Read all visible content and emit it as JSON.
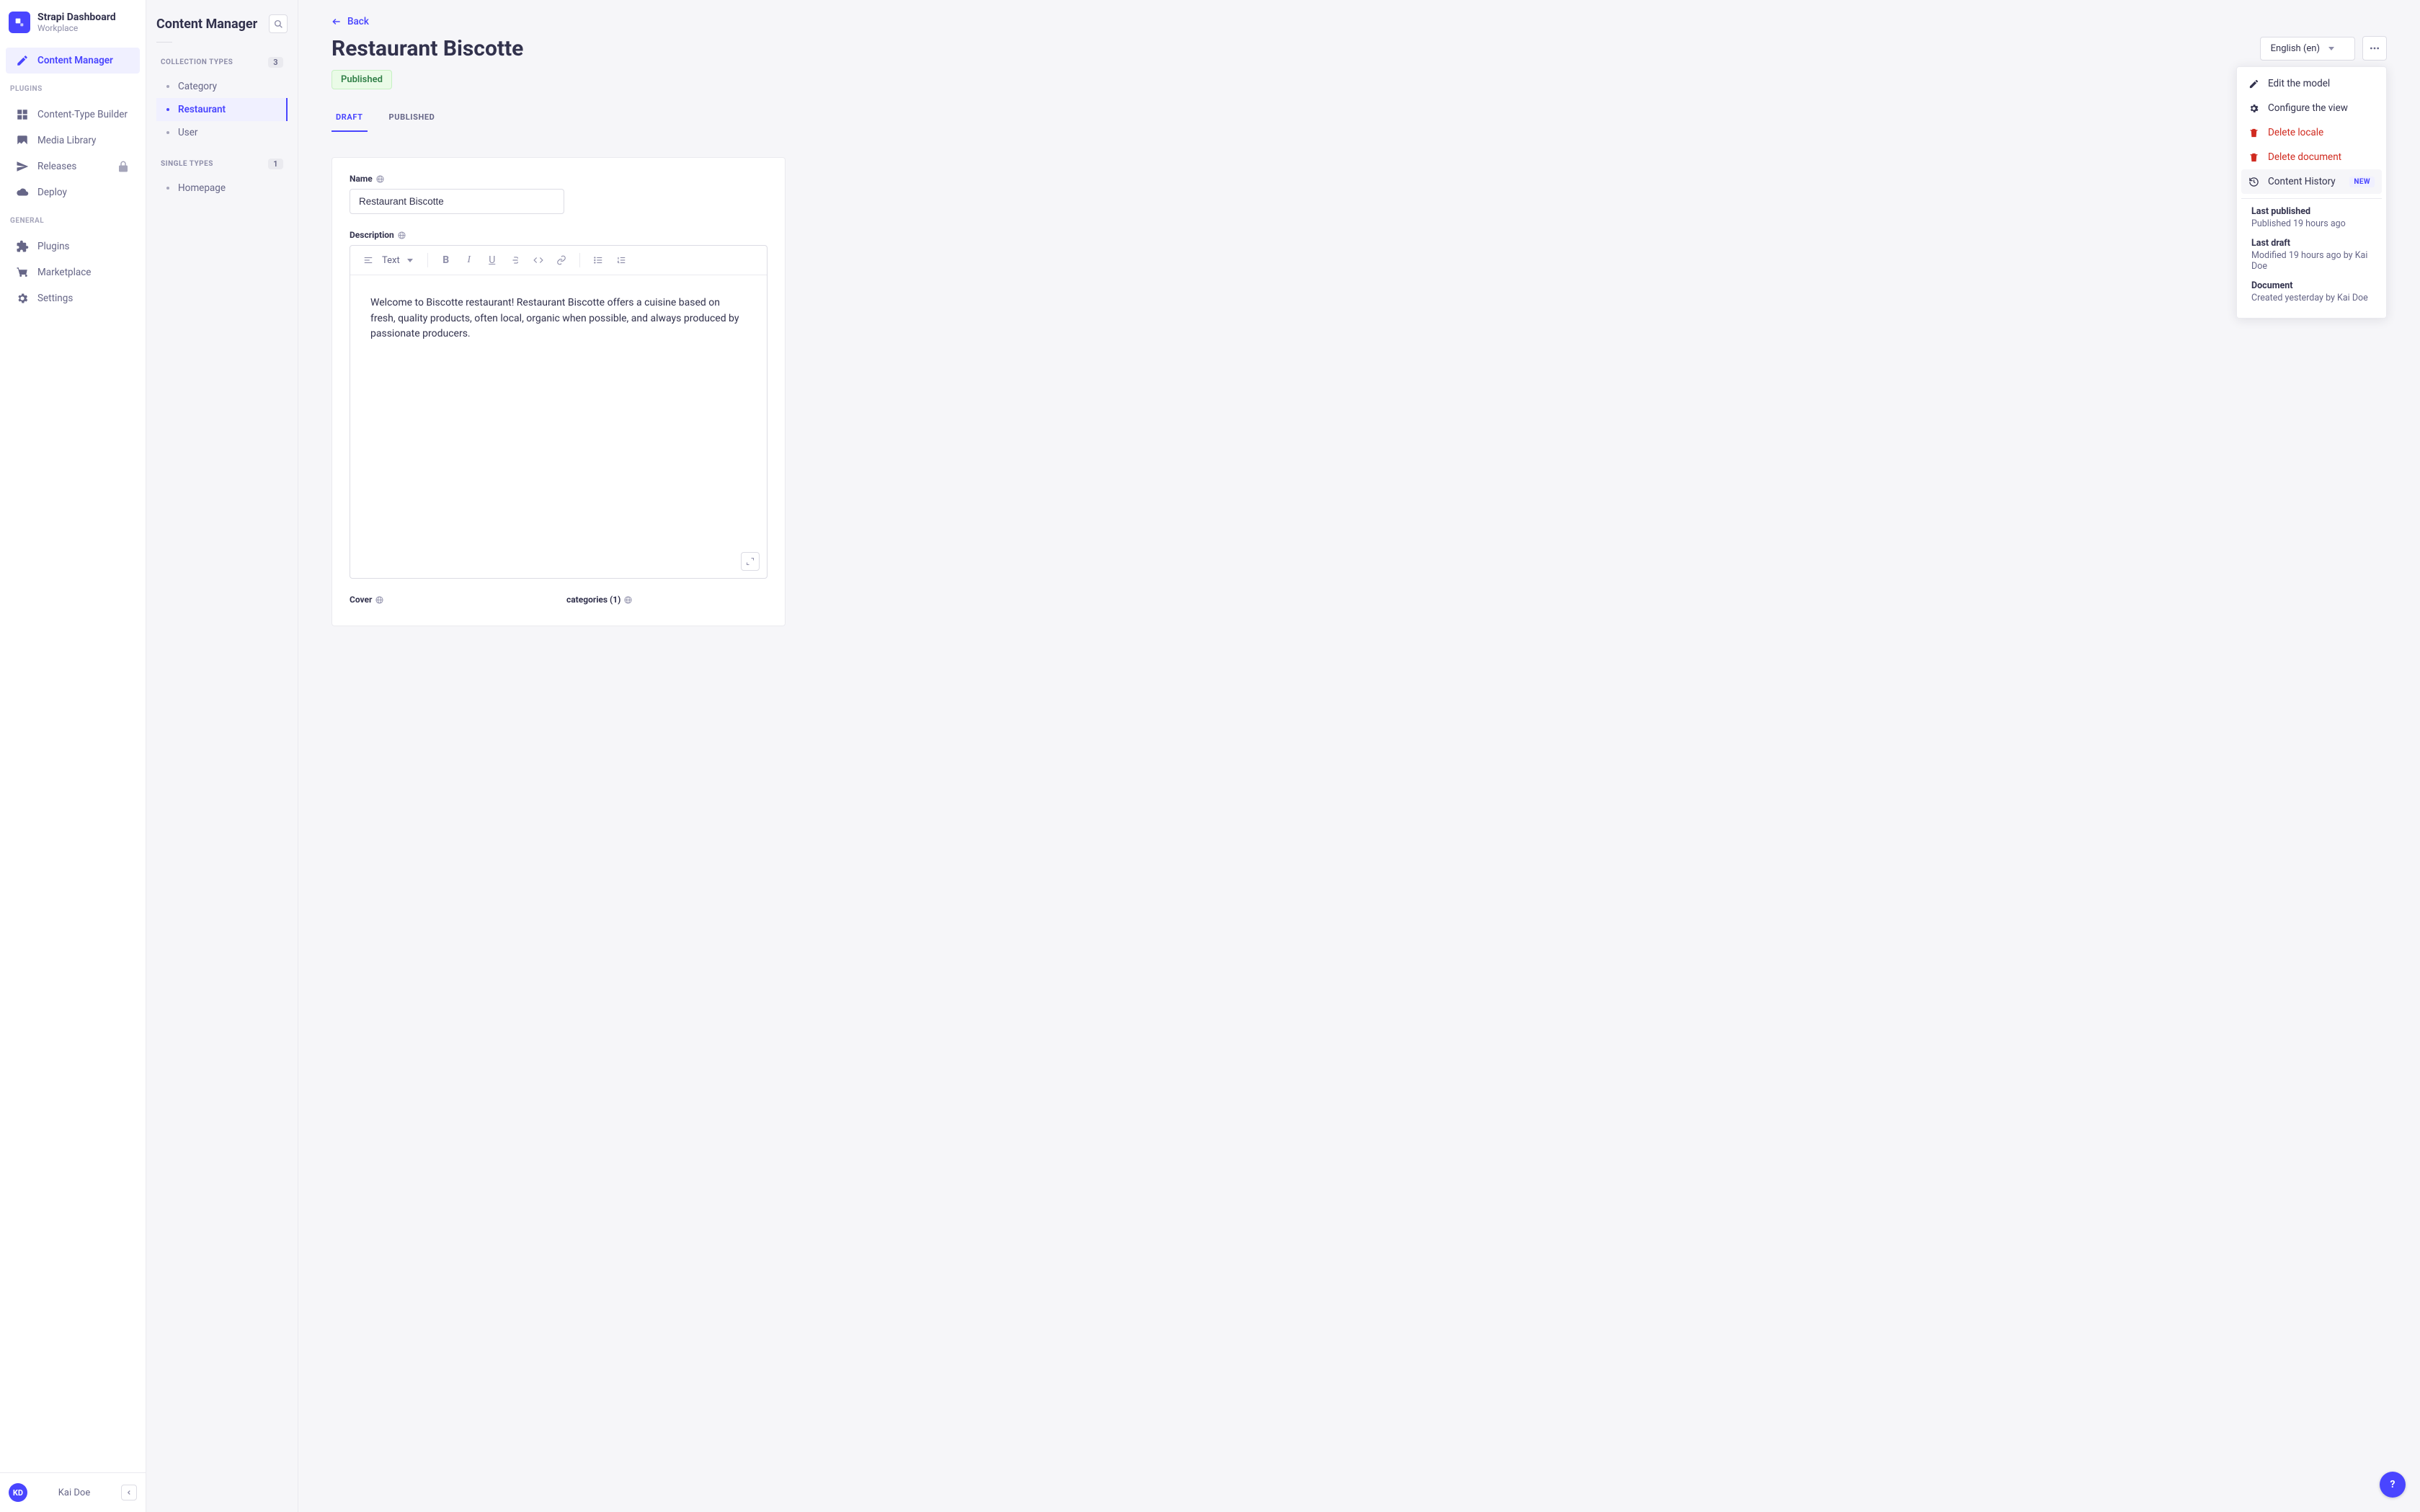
{
  "brand": {
    "title": "Strapi Dashboard",
    "subtitle": "Workplace"
  },
  "nav": {
    "main": {
      "content_manager": "Content Manager"
    },
    "plugins_heading": "PLUGINS",
    "plugins": {
      "content_type_builder": "Content-Type Builder",
      "media_library": "Media Library",
      "releases": "Releases",
      "deploy": "Deploy"
    },
    "general_heading": "GENERAL",
    "general": {
      "plugins": "Plugins",
      "marketplace": "Marketplace",
      "settings": "Settings"
    }
  },
  "user": {
    "initials": "KD",
    "name": "Kai Doe"
  },
  "second": {
    "title": "Content Manager",
    "collection_heading": "COLLECTION TYPES",
    "collection_count": "3",
    "collection_items": {
      "category": "Category",
      "restaurant": "Restaurant",
      "user": "User"
    },
    "single_heading": "SINGLE TYPES",
    "single_count": "1",
    "single_items": {
      "homepage": "Homepage"
    }
  },
  "page": {
    "back": "Back",
    "title": "Restaurant Biscotte",
    "locale": "English (en)",
    "status": "Published",
    "tab_draft": "Draft",
    "tab_published": "Published"
  },
  "form": {
    "name_label": "Name",
    "name_value": "Restaurant Biscotte",
    "description_label": "Description",
    "editor_text_label": "Text",
    "description_value": "Welcome to Biscotte restaurant! Restaurant Biscotte offers a cuisine based on fresh, quality products, often local, organic when possible, and always produced by passionate producers.",
    "cover_label": "Cover",
    "categories_label": "categories (1)"
  },
  "menu": {
    "edit_model": "Edit the model",
    "configure_view": "Configure the view",
    "delete_locale": "Delete locale",
    "delete_document": "Delete document",
    "content_history": "Content History",
    "new_badge": "NEW"
  },
  "info": {
    "last_published_label": "Last published",
    "last_published_value": "Published 19 hours ago",
    "last_draft_label": "Last draft",
    "last_draft_value": "Modified 19 hours ago by Kai Doe",
    "document_label": "Document",
    "document_value": "Created yesterday by Kai Doe"
  },
  "help": {
    "glyph": "?"
  }
}
